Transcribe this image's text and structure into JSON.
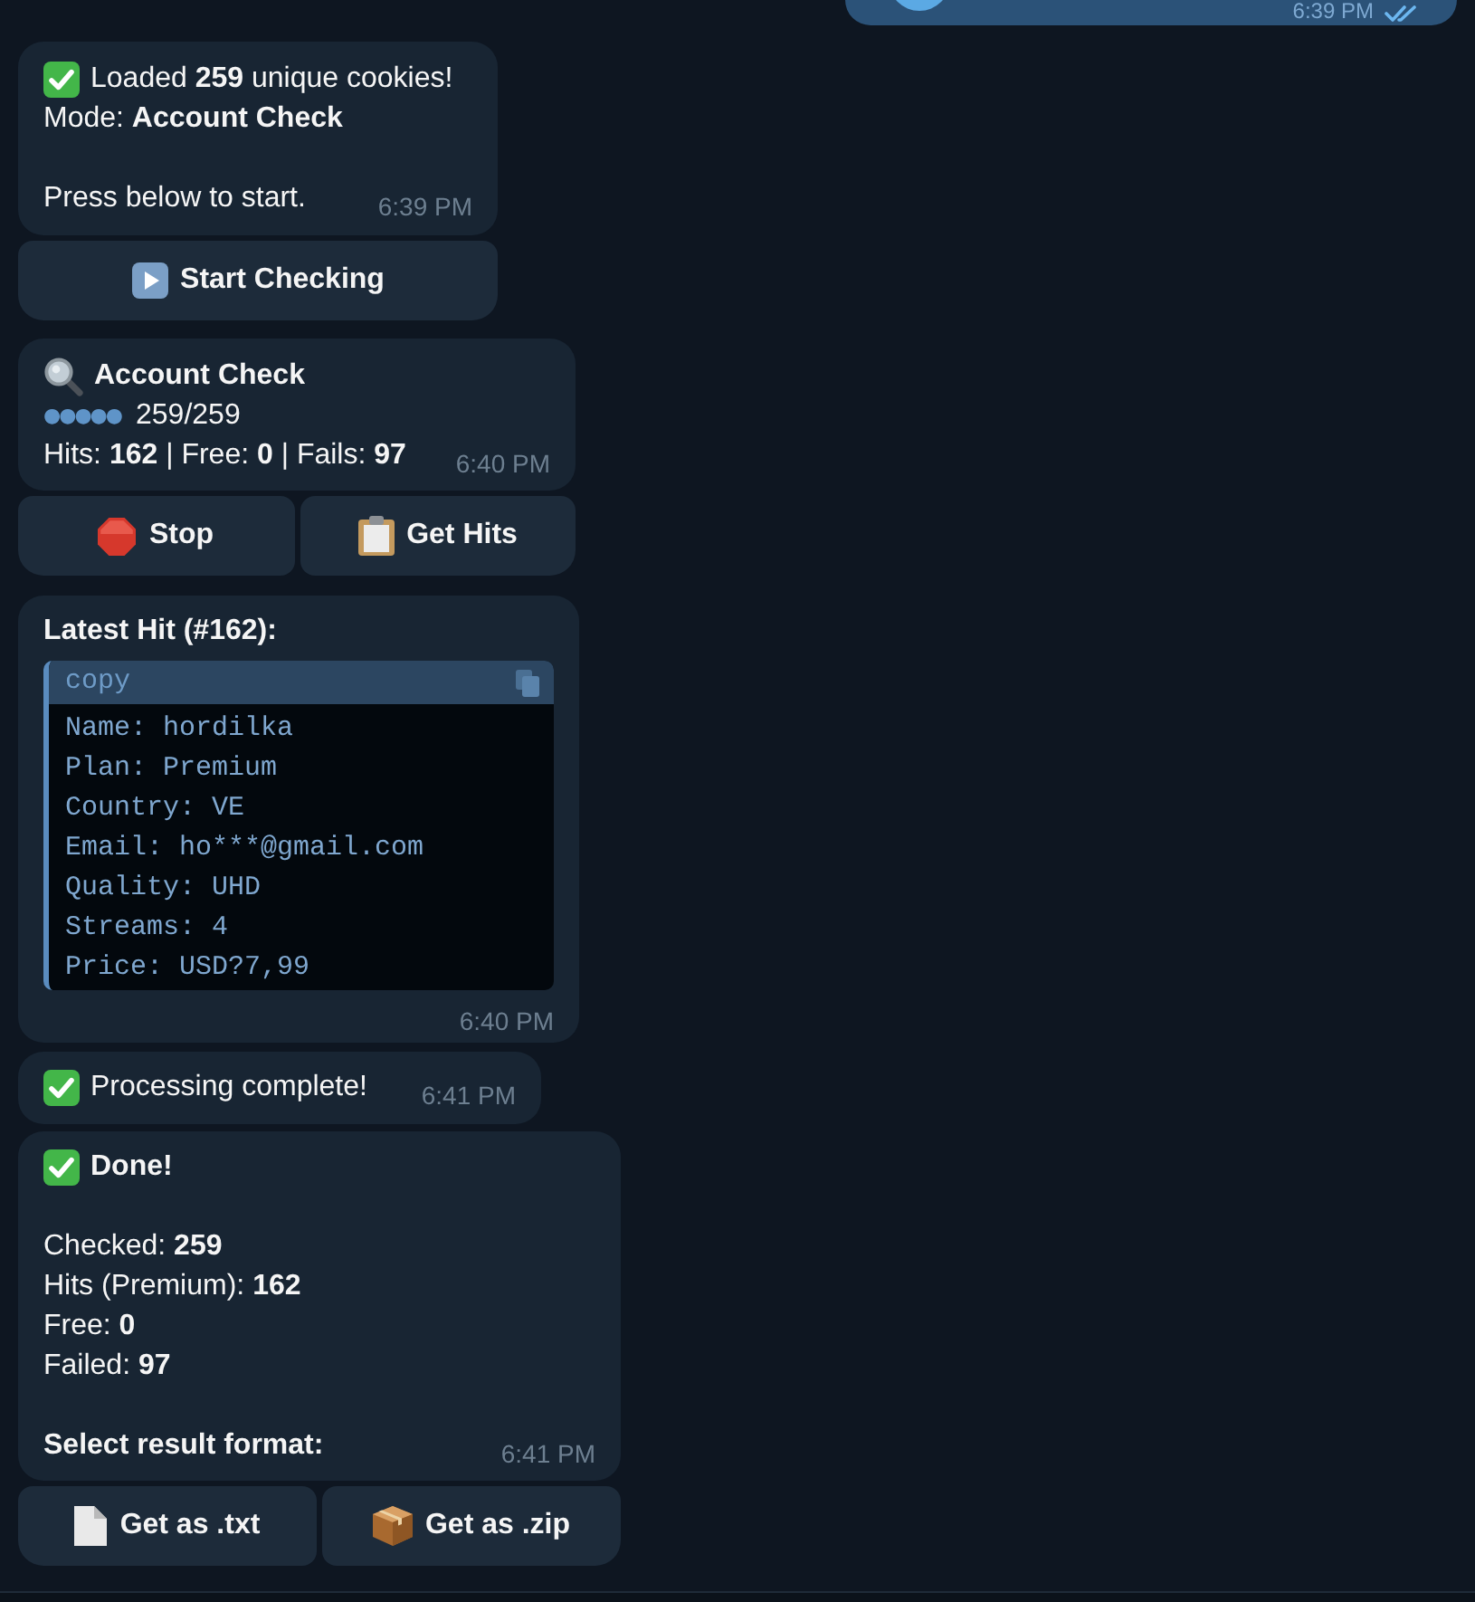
{
  "outgoing_message": {
    "time": "6:39 PM"
  },
  "load_message": {
    "lines": [
      "Loaded **259** unique cookies!",
      "Mode: **Account Check**"
    ],
    "note": "Press below to start.",
    "time": "6:39 PM",
    "buttons": [
      {
        "label": "Start Checking"
      }
    ]
  },
  "progress_message": {
    "title": "Account Check",
    "dots": "●●●●●",
    "progress": "259/259",
    "summary": "Hits: **162** | Free: **0** | Fails: **97**",
    "time": "6:40 PM",
    "buttons": [
      {
        "label": "Stop"
      },
      {
        "label": "Get Hits"
      }
    ]
  },
  "hit_message": {
    "title": "Latest Hit (#162):",
    "code": {
      "header": "copy",
      "lines": [
        "Name: hordilka",
        "Plan: Premium",
        "Country: VE",
        "Email: ho***@gmail.com",
        "Quality: UHD",
        "Streams: 4",
        "Price: USD?7,99"
      ]
    },
    "time": "6:40 PM"
  },
  "complete_message": {
    "text": "Processing complete!",
    "time": "6:41 PM"
  },
  "done_message": {
    "title": "Done!",
    "stats": [
      "Checked: **259**",
      "Hits (Premium): **162**",
      "Free: **0**",
      "Failed: **97**"
    ],
    "prompt": "Select result format:",
    "time": "6:41 PM",
    "buttons": [
      {
        "label": "Get as .txt"
      },
      {
        "label": "Get as .zip"
      }
    ]
  }
}
